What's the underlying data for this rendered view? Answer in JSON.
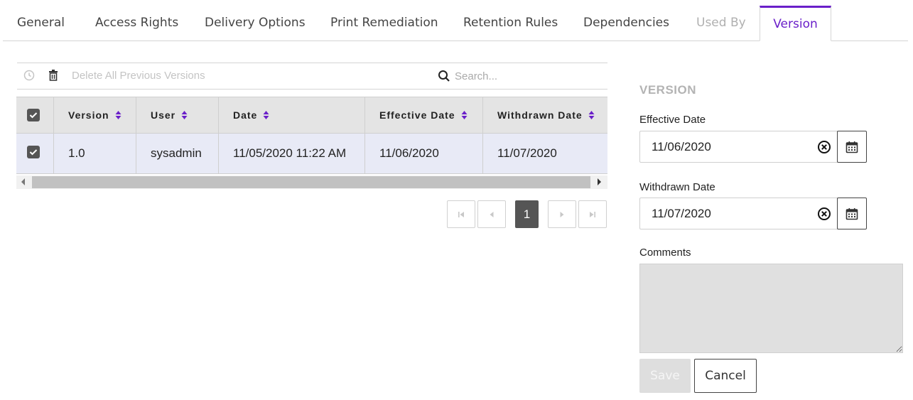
{
  "tabs": [
    {
      "label": "General"
    },
    {
      "label": "Access Rights"
    },
    {
      "label": "Delivery Options"
    },
    {
      "label": "Print Remediation"
    },
    {
      "label": "Retention Rules"
    },
    {
      "label": "Dependencies"
    },
    {
      "label": "Used By",
      "state": "disabled"
    },
    {
      "label": "Version",
      "state": "active"
    }
  ],
  "toolbar": {
    "delete_label": "Delete All Previous Versions",
    "search_placeholder": "Search..."
  },
  "table": {
    "columns": [
      "Version",
      "User",
      "Date",
      "Effective Date",
      "Withdrawn Date"
    ],
    "rows": [
      {
        "selected": true,
        "version": "1.0",
        "user": "sysadmin",
        "date": "11/05/2020 11:22 AM",
        "effective_date": "11/06/2020",
        "withdrawn_date": "11/07/2020"
      }
    ]
  },
  "pagination": {
    "current_page": "1"
  },
  "version_panel": {
    "title": "VERSION",
    "effective_label": "Effective Date",
    "effective_value": "11/06/2020",
    "withdrawn_label": "Withdrawn Date",
    "withdrawn_value": "11/07/2020",
    "comments_label": "Comments",
    "comments_value": "",
    "save_label": "Save",
    "cancel_label": "Cancel"
  },
  "colors": {
    "accent": "#6a1fc9",
    "row_selected": "#e8eaf6",
    "header_bg": "#e4e4e4"
  }
}
